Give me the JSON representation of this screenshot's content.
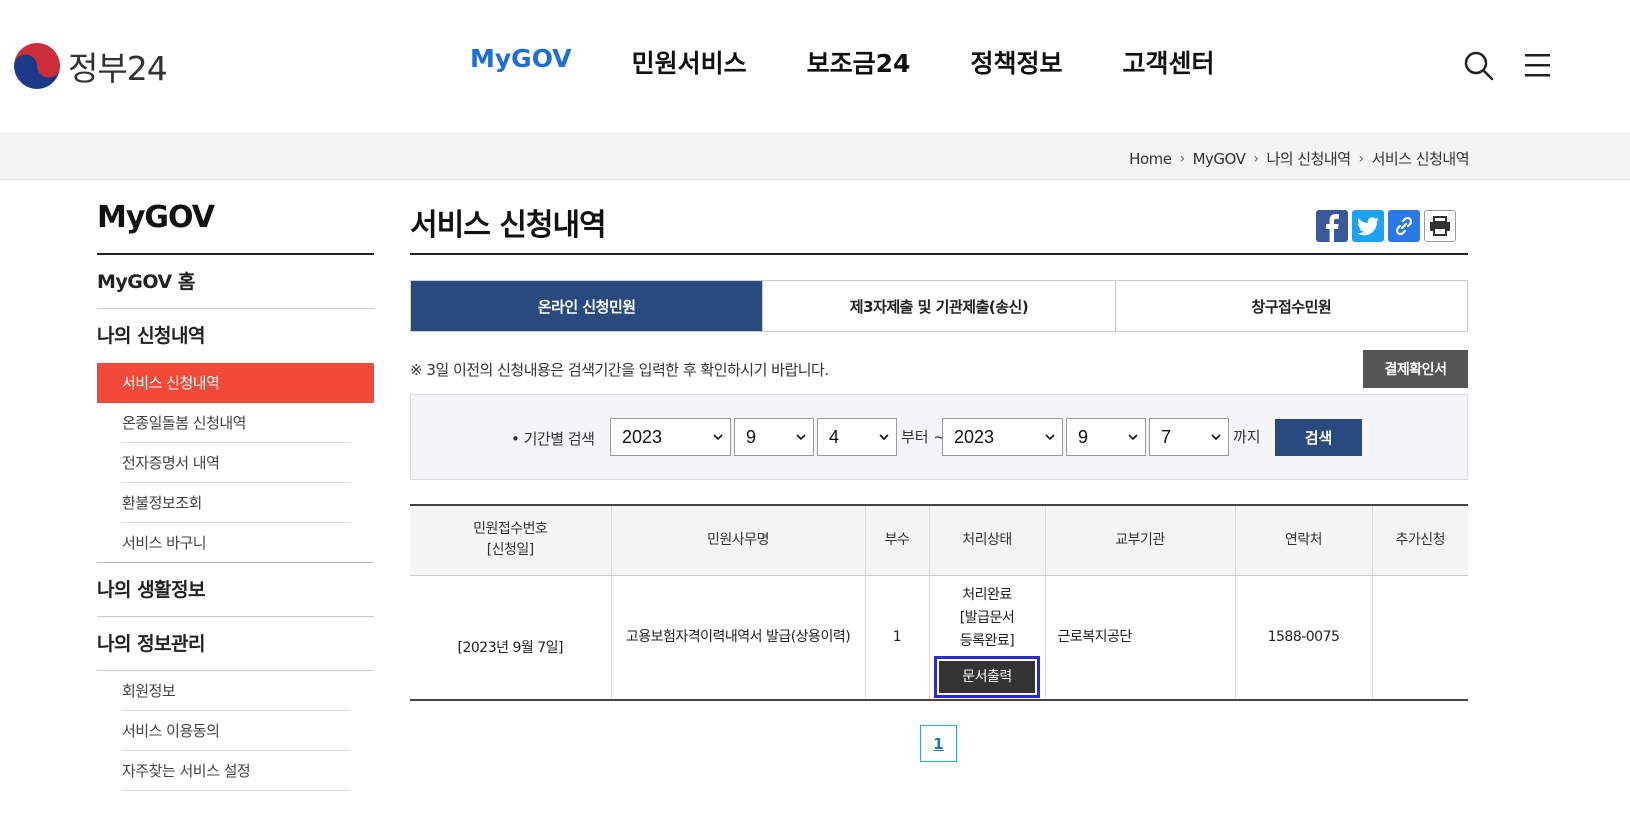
{
  "header": {
    "logo_text": "정부24",
    "nav": [
      {
        "label": "MyGOV"
      },
      {
        "label": "민원서비스"
      },
      {
        "label": "보조금24"
      },
      {
        "label": "정책정보"
      },
      {
        "label": "고객센터"
      }
    ],
    "search_icon": "search-icon",
    "menu_icon": "hamburger-menu-icon"
  },
  "breadcrumb": [
    "Home",
    "MyGOV",
    "나의 신청내역",
    "서비스 신청내역"
  ],
  "sidebar": {
    "title": "MyGOV",
    "home": "MyGOV 홈",
    "group1": "나의 신청내역",
    "group1_items": [
      "서비스 신청내역",
      "온종일돌봄 신청내역",
      "전자증명서 내역",
      "환불정보조회",
      "서비스 바구니"
    ],
    "group2": "나의 생활정보",
    "group3": "나의 정보관리",
    "group3_items": [
      "회원정보",
      "서비스 이용동의",
      "자주찾는 서비스 설정"
    ]
  },
  "main": {
    "title": "서비스 신청내역",
    "share_icons": [
      "facebook-icon",
      "twitter-icon",
      "link-icon",
      "print-icon"
    ],
    "tabs": [
      "온라인 신청민원",
      "제3자제출 및 기관제출(송신)",
      "창구접수민원"
    ],
    "notice": "※ 3일 이전의 신청내용은 검색기간을 입력한 후 확인하시기 바랍니다.",
    "confirm_button": "결제확인서",
    "search": {
      "label": "• 기간별 검색",
      "from_year": "2023",
      "from_month": "9",
      "from_day": "4",
      "from_text": "부터 ~",
      "to_year": "2023",
      "to_month": "9",
      "to_day": "7",
      "to_text": "까지",
      "button": "검색"
    },
    "table": {
      "headers": [
        "민원접수번호",
        "[신청일]",
        "민원사무명",
        "부수",
        "처리상태",
        "교부기관",
        "연락처",
        "추가신청"
      ],
      "row": {
        "receipt_no": "",
        "date": "[2023년 9월 7일]",
        "service_name": "고용보험자격이력내역서 발급(상용이력)",
        "copies": "1",
        "status_line1": "처리완료",
        "status_line2": "[발급문서",
        "status_line3": "등록완료]",
        "print_button": "문서출력",
        "agency": "근로복지공단",
        "contact": "1588-0075",
        "extra": ""
      }
    },
    "pagination": {
      "current": "1"
    }
  }
}
